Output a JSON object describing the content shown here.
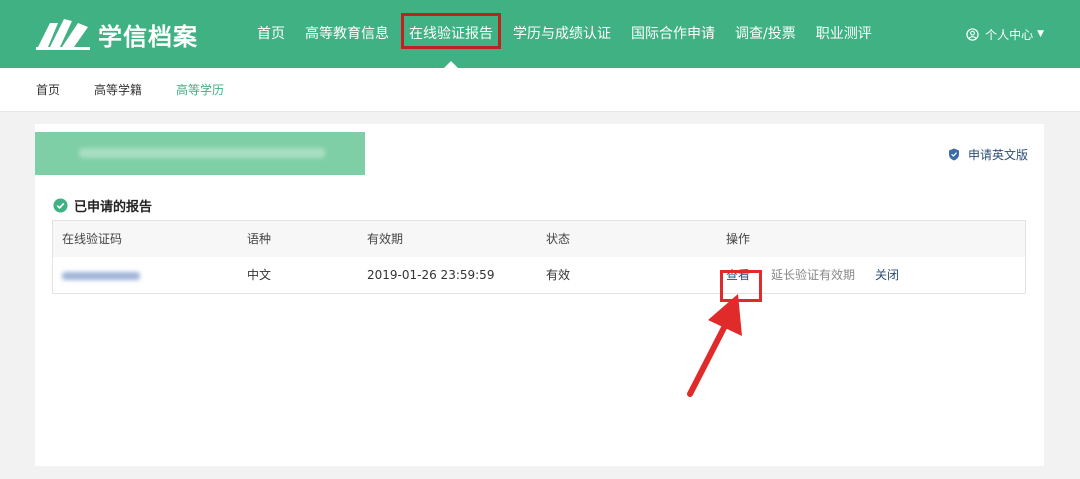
{
  "brand": {
    "name": "学信档案",
    "color": "#3fb182"
  },
  "nav": {
    "items": [
      {
        "label": "首页",
        "active": false
      },
      {
        "label": "高等教育信息",
        "active": false
      },
      {
        "label": "在线验证报告",
        "active": true
      },
      {
        "label": "学历与成绩认证",
        "active": false
      },
      {
        "label": "国际合作申请",
        "active": false
      },
      {
        "label": "调查/投票",
        "active": false
      },
      {
        "label": "职业测评",
        "active": false
      }
    ],
    "user_label": "个人中心"
  },
  "breadcrumb": [
    "首页",
    "高等学籍",
    "高等学历"
  ],
  "card": {
    "english_link": "申请英文版",
    "section_title": "已申请的报告",
    "table": {
      "headers": [
        "在线验证码",
        "语种",
        "有效期",
        "状态",
        "操作"
      ],
      "rows": [
        {
          "language": "中文",
          "expiry": "2019-01-26 23:59:59",
          "status": "有效",
          "actions": {
            "view": "查看",
            "extend": "延长验证有效期",
            "close": "关闭"
          }
        }
      ]
    }
  },
  "icons": {
    "logo": "book-logo-icon",
    "user": "user-circle-icon",
    "english": "shield-icon",
    "section": "check-circle-icon",
    "annotation": "red-arrow-icon"
  },
  "colors": {
    "highlight": "#c0201f",
    "link": "#2b4f7a",
    "arrow": "#e12a2a"
  }
}
